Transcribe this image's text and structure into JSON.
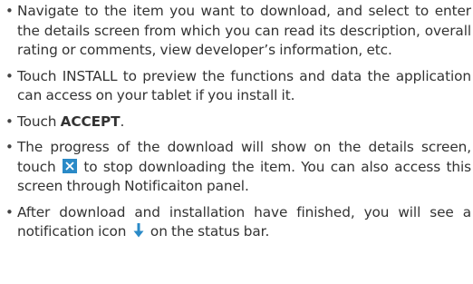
{
  "instructions": [
    {
      "text": "Navigate to the item you want to download, and select to enter the details screen from which you can read its description, overall rating or comments, view developer’s information, etc."
    },
    {
      "text": "Touch INSTALL to preview the functions and data the application can access on your tablet if you install it."
    },
    {
      "prefix": "Touch ",
      "bold": "ACCEPT",
      "suffix": "."
    },
    {
      "before_icon": "The progress of the download will show on the details screen, touch ",
      "icon": "cancel-download-icon",
      "after_icon": " to stop downloading the item. You can also access this screen through Notificaiton panel."
    },
    {
      "before_icon": "After download and installation have finished, you will see a notification icon ",
      "icon": "download-arrow-icon",
      "after_icon": " on the status bar."
    }
  ],
  "colors": {
    "text": "#333333",
    "icon_blue": "#2a8ac7"
  }
}
